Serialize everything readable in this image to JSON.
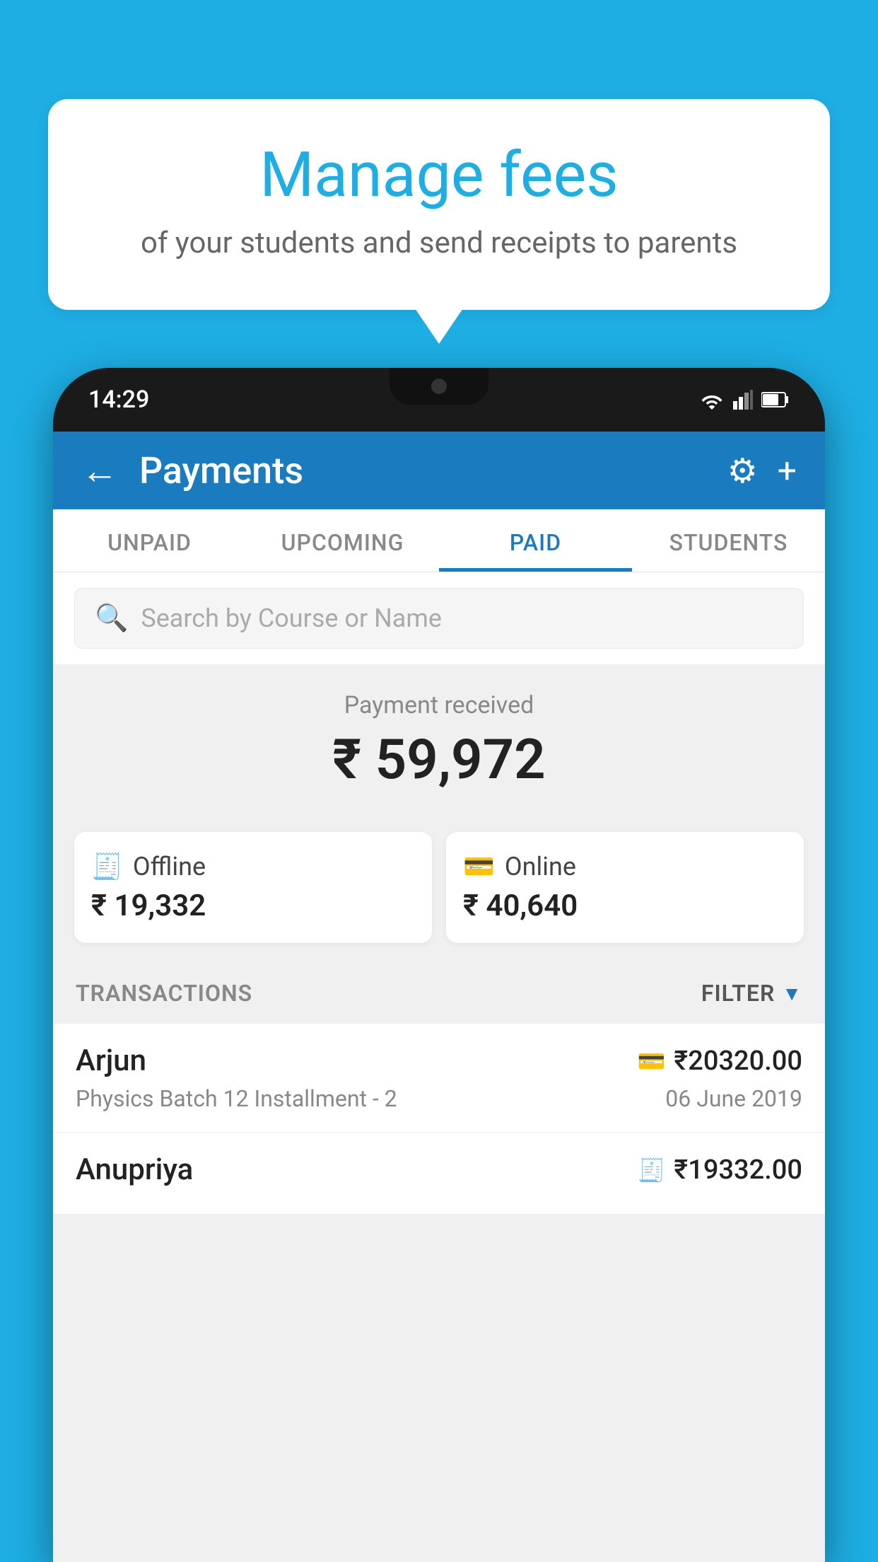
{
  "background_color": "#1EAEE4",
  "speech_bubble": {
    "title": "Manage fees",
    "subtitle": "of your students and send receipts to parents"
  },
  "phone": {
    "status_bar": {
      "time": "14:29"
    },
    "header": {
      "back_label": "←",
      "title": "Payments",
      "gear_icon": "⚙",
      "plus_icon": "+"
    },
    "tabs": [
      {
        "label": "UNPAID",
        "active": false
      },
      {
        "label": "UPCOMING",
        "active": false
      },
      {
        "label": "PAID",
        "active": true
      },
      {
        "label": "STUDENTS",
        "active": false
      }
    ],
    "search": {
      "placeholder": "Search by Course or Name"
    },
    "payment_summary": {
      "label": "Payment received",
      "amount": "₹ 59,972",
      "offline": {
        "label": "Offline",
        "amount": "₹ 19,332"
      },
      "online": {
        "label": "Online",
        "amount": "₹ 40,640"
      }
    },
    "transactions": {
      "section_label": "TRANSACTIONS",
      "filter_label": "FILTER",
      "rows": [
        {
          "name": "Arjun",
          "description": "Physics Batch 12 Installment - 2",
          "amount": "₹20320.00",
          "date": "06 June 2019",
          "payment_type": "online"
        },
        {
          "name": "Anupriya",
          "description": "",
          "amount": "₹19332.00",
          "date": "",
          "payment_type": "offline"
        }
      ]
    }
  }
}
